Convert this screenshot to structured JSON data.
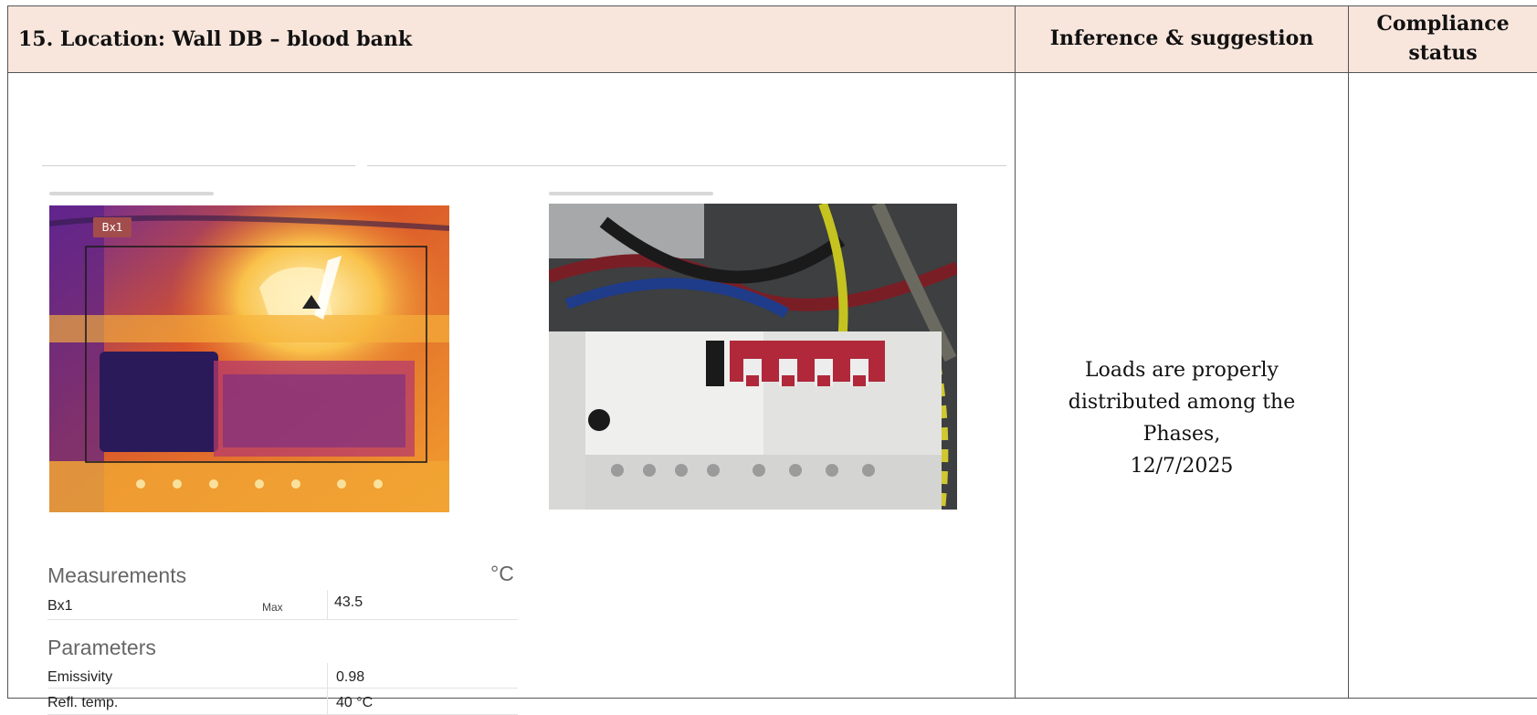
{
  "header": {
    "location": "15. Location: Wall DB – blood bank",
    "inference": "Inference & suggestion",
    "compliance_line1": "Compliance",
    "compliance_line2": "status"
  },
  "thermal_image": {
    "box_label": "Bx1"
  },
  "measurements": {
    "title": "Measurements",
    "unit": "°C",
    "rows": [
      {
        "name": "Bx1",
        "type": "Max",
        "value": "43.5"
      }
    ]
  },
  "parameters": {
    "title": "Parameters",
    "rows": [
      {
        "name": "Emissivity",
        "value": "0.98"
      },
      {
        "name": "Refl. temp.",
        "value": "40 °C"
      }
    ]
  },
  "inference": {
    "line1": "Loads are properly",
    "line2": "distributed among the",
    "line3": "Phases,",
    "line4": "12/7/2025"
  },
  "compliance": {
    "status": ""
  }
}
